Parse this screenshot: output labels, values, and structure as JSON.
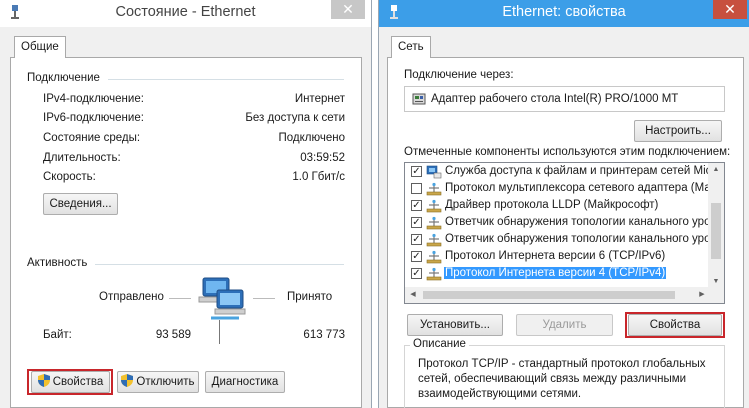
{
  "left_window": {
    "title": "Состояние - Ethernet",
    "close_glyph": "✕",
    "tab": "Общие",
    "connection": {
      "group_label": "Подключение",
      "rows": [
        {
          "label": "IPv4-подключение:",
          "value": "Интернет"
        },
        {
          "label": "IPv6-подключение:",
          "value": "Без доступа к сети"
        },
        {
          "label": "Состояние среды:",
          "value": "Подключено"
        },
        {
          "label": "Длительность:",
          "value": "03:59:52"
        },
        {
          "label": "Скорость:",
          "value": "1.0 Гбит/с"
        }
      ],
      "details_button": "Сведения..."
    },
    "activity": {
      "group_label": "Активность",
      "sent_label": "Отправлено",
      "received_label": "Принято",
      "bytes_label": "Байт:",
      "bytes_sent": "93 589",
      "bytes_received": "613 773"
    },
    "buttons": {
      "properties": "Свойства",
      "disable": "Отключить",
      "diagnostics": "Диагностика"
    }
  },
  "right_window": {
    "title": "Ethernet: свойства",
    "close_glyph": "✕",
    "tab": "Сеть",
    "connect_using_label": "Подключение через:",
    "adapter_name": "Адаптер рабочего стола Intel(R) PRO/1000 MT",
    "configure_button": "Настроить...",
    "components_label": "Отмеченные компоненты используются этим подключением:",
    "components": [
      {
        "label": "Служба доступа к файлам и принтерам сетей Micro",
        "checked": true,
        "selected": false,
        "icon": "file-sharing-icon"
      },
      {
        "label": "Протокол мультиплексора сетевого адаптера (Майк",
        "checked": false,
        "selected": false,
        "icon": "protocol-icon"
      },
      {
        "label": "Драйвер протокола LLDP (Майкрософт)",
        "checked": true,
        "selected": false,
        "icon": "protocol-icon"
      },
      {
        "label": "Ответчик обнаружения топологии канального уров",
        "checked": true,
        "selected": false,
        "icon": "protocol-icon"
      },
      {
        "label": "Ответчик обнаружения топологии канального уров",
        "checked": true,
        "selected": false,
        "icon": "protocol-icon"
      },
      {
        "label": "Протокол Интернета версии 6 (TCP/IPv6)",
        "checked": true,
        "selected": false,
        "icon": "protocol-icon"
      },
      {
        "label": "Протокол Интернета версии 4 (TCP/IPv4)",
        "checked": true,
        "selected": true,
        "icon": "protocol-icon"
      }
    ],
    "buttons": {
      "install": "Установить...",
      "remove": "Удалить",
      "properties": "Свойства"
    },
    "description": {
      "label": "Описание",
      "text": "Протокол TCP/IP - стандартный протокол глобальных\nсетей, обеспечивающий связь между различными\nвзаимодействующими сетями."
    }
  },
  "colors": {
    "right_titlebar": "#3c9ee8",
    "selection": "#3399ff",
    "highlight_border": "#c8262b"
  }
}
